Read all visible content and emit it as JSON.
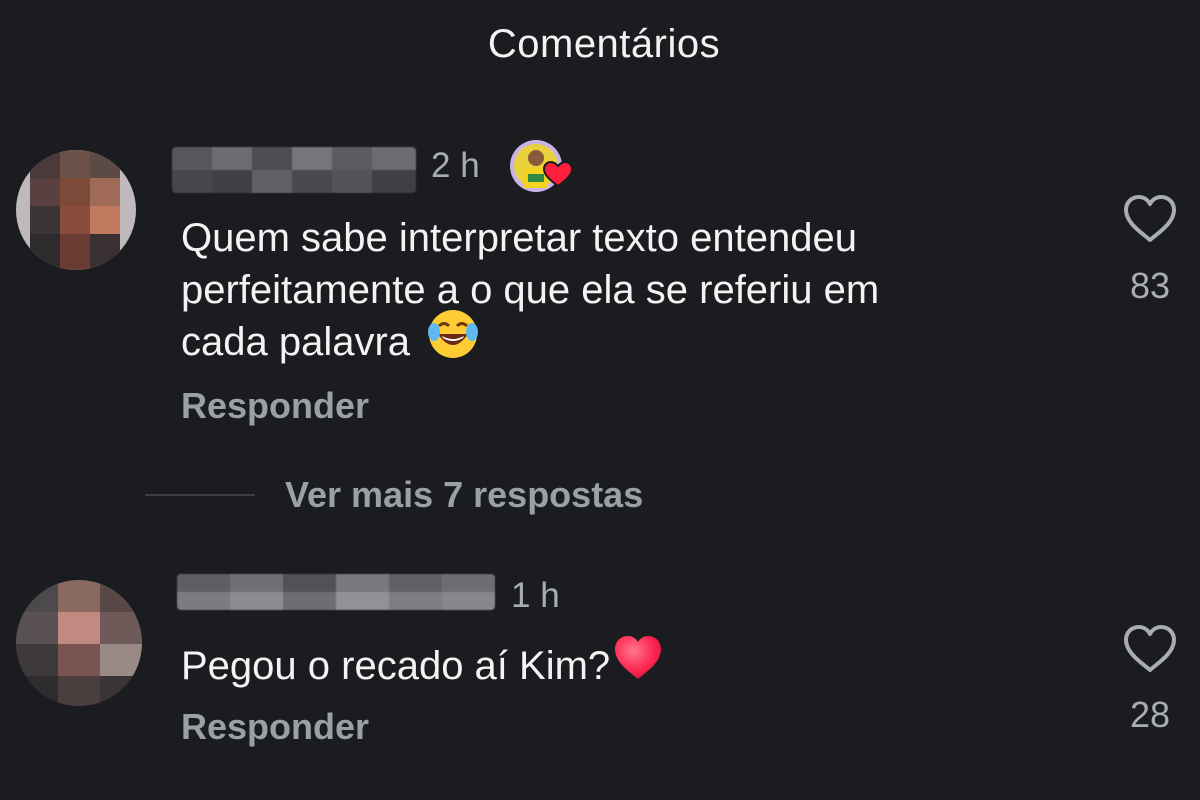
{
  "header": {
    "title": "Comentários"
  },
  "comments": [
    {
      "time": "2 h",
      "text": "Quem sabe interpretar texto entendeu\nperfeitamente a o que ela se referiu em\ncada palavra ",
      "emoji": "face-with-tears-of-joy",
      "reply_label": "Responder",
      "likes": "83",
      "creator_liked": true
    },
    {
      "time": "1 h",
      "text": "Pegou o recado aí Kim?",
      "emoji": "red-heart",
      "reply_label": "Responder",
      "likes": "28",
      "creator_liked": false
    }
  ],
  "thread": {
    "more_replies_label": "Ver mais 7 respostas"
  },
  "colors": {
    "background": "#1b1c1f",
    "text": "#f3f3f3",
    "muted": "#9aa0a6",
    "heart_red": "#ff3040"
  }
}
